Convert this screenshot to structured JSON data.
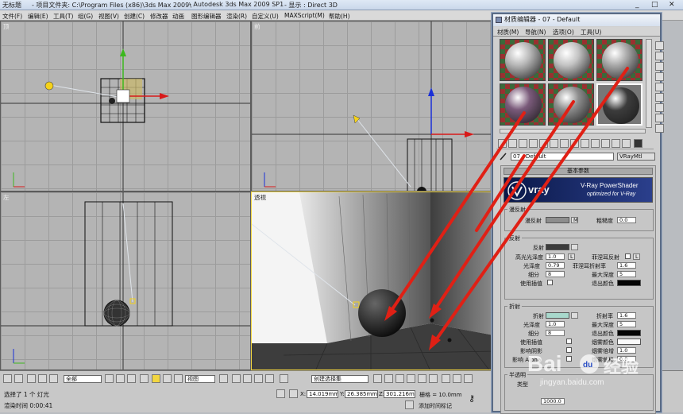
{
  "window": {
    "doc_name": "无标题",
    "project_folder": "- 项目文件夹: C:\\Program Files (x86)\\3ds Max 2009\\",
    "app_title": "- Autodesk 3ds Max  2009 SP1",
    "display": "- 显示 : Direct 3D",
    "controls": [
      "_",
      "□",
      "✕"
    ]
  },
  "menu": [
    "文件(F)",
    "编辑(E)",
    "工具(T)",
    "组(G)",
    "视图(V)",
    "创建(C)",
    "修改器",
    "动画",
    "图形编辑器",
    "渲染(R)",
    "自定义(U)",
    "MAXScript(M)",
    "帮助(H)"
  ],
  "viewports": {
    "top_left": "顶",
    "top_right": "前",
    "bottom_left": "左",
    "bottom_right": "透视"
  },
  "bottom": {
    "filter_select": "全部",
    "view_select": "视图",
    "selection_set": "创建选择集",
    "status_selection": "选择了 1 个 灯光",
    "status_hint": "渲染时间  0:00:41",
    "x_label": "X:",
    "x_value": "14.019mm",
    "y_label": "Y:",
    "y_value": "26.385mm",
    "z_label": "Z:",
    "z_value": "301.216mm",
    "grid_label": "栅格 = 10.0mm",
    "add_time_tag": "添加时间标记"
  },
  "material_editor": {
    "title": "材质编辑器 - 07 - Default",
    "menu": [
      "材质(M)",
      "导航(N)",
      "选项(O)",
      "工具(U)"
    ],
    "slots_colors": [
      "#b8b8b8",
      "#c4c4c4",
      "#aaaaaa",
      "#7a5a7a",
      "#8e8e8e",
      "#3c3c3c"
    ],
    "material_name": "07 - Default",
    "material_type": "VRayMtl",
    "params_title": "基本参数",
    "vray_logo": "vray",
    "vray_banner_line1": "V-Ray PowerShader",
    "vray_banner_line2": "optimized for V-Ray",
    "diffuse": {
      "section": "漫反射",
      "label": "漫反射",
      "m_btn": "M",
      "roughness_label": "粗糙度",
      "roughness": "0.0"
    },
    "reflection": {
      "section": "反射",
      "reflect_label": "反射",
      "hilight_gloss_label": "高光光泽度",
      "hilight_gloss": "1.0",
      "l_btn": "L",
      "fresnel_label": "菲涅耳反射",
      "refl_gloss_label": "光泽度",
      "refl_gloss": "0.79",
      "fresnel_ior_label": "菲涅耳折射率",
      "fresnel_ior": "1.6",
      "subdivs_label": "细分",
      "subdivs": "8",
      "max_depth_label": "最大深度",
      "max_depth": "5",
      "use_interp_label": "使用插值",
      "exit_color_label": "退出颜色"
    },
    "refraction": {
      "section": "折射",
      "refract_label": "折射",
      "ior_label": "折射率",
      "ior": "1.6",
      "gloss_label": "光泽度",
      "gloss": "1.0",
      "max_depth_label": "最大深度",
      "max_depth": "5",
      "subdivs_label": "细分",
      "subdivs": "8",
      "exit_color_label": "退出颜色",
      "use_interp_label": "使用插值",
      "fog_color_label": "烟雾颜色",
      "affect_shadows_label": "影响阴影",
      "fog_mult_label": "烟雾倍增",
      "fog_mult": "1.0",
      "affect_alpha_label": "影响 Alpha",
      "fog_bias_label": "烟雾偏移",
      "fog_bias": "0.0"
    },
    "translucency": {
      "section": "半透明",
      "type_label": "类型",
      "value": "1000.0"
    }
  },
  "watermark": {
    "brand": "Bai",
    "brand_cn": "经验",
    "du": "du",
    "url": "jingyan.baidu.com"
  },
  "colors": {
    "accent_red": "#e02015",
    "axis_green": "#3cb81e",
    "axis_red": "#d81a1a",
    "axis_blue": "#1a2fd8",
    "light_yellow": "#f5d21a"
  }
}
